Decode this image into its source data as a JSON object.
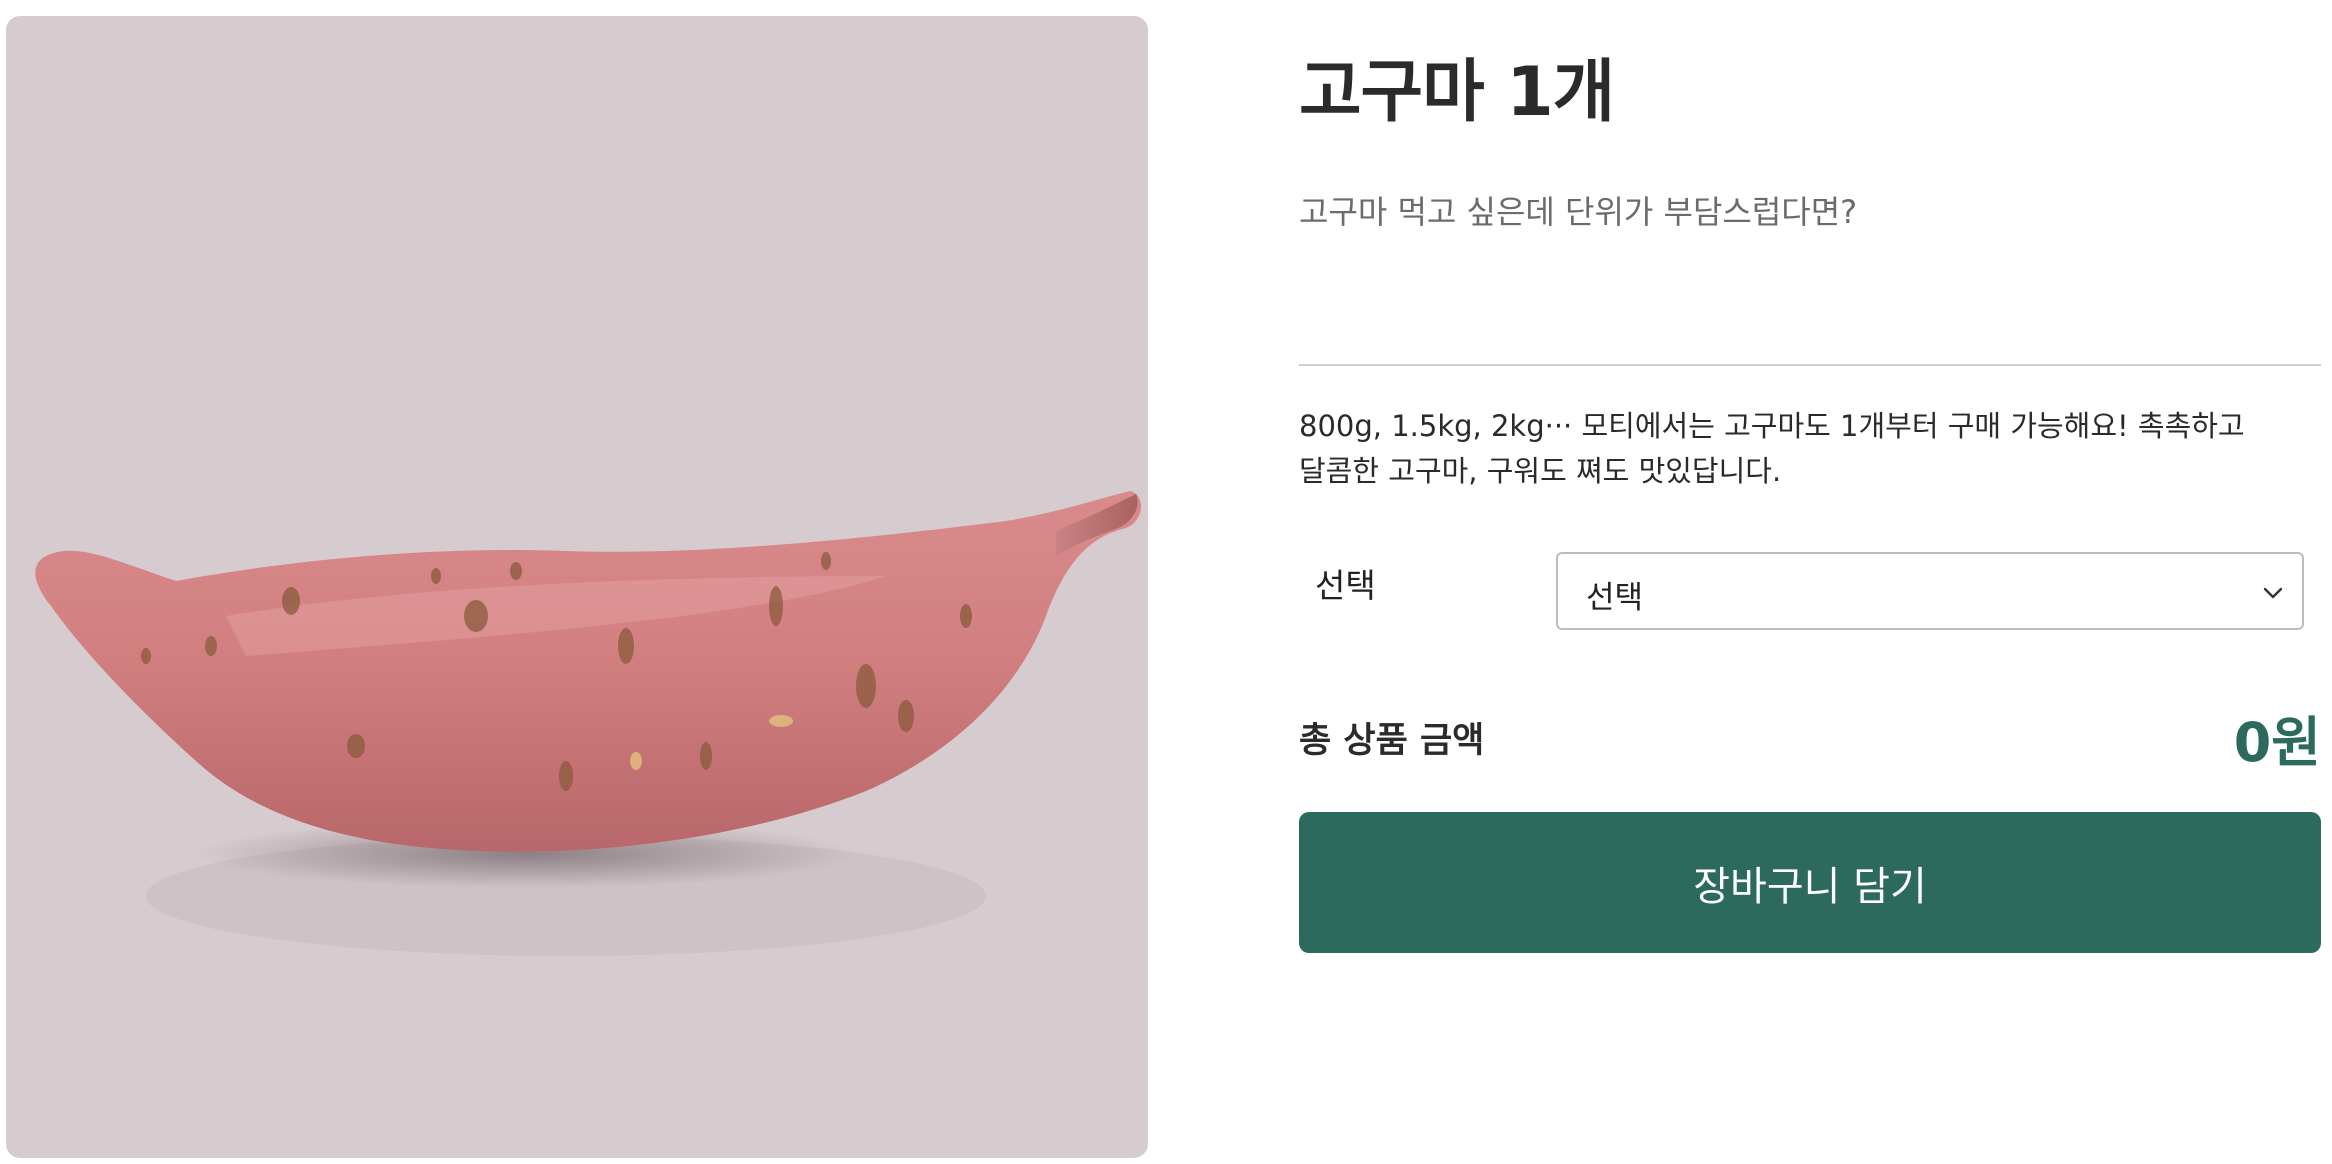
{
  "product": {
    "image_alt": "sweet-potato",
    "title": "고구마 1개",
    "subtitle": "고구마 먹고 싶은데 단위가 부담스럽다면?",
    "description": "800g, 1.5kg, 2kg··· 모티에서는 고구마도 1개부터 구매 가능해요! 촉촉하고 달콤한 고구마, 구워도 쪄도 맛있답니다."
  },
  "option": {
    "label": "선택",
    "selected": "선택",
    "icon": "chevron-down-icon"
  },
  "total": {
    "label": "총 상품 금액",
    "value": "0원"
  },
  "actions": {
    "add_to_cart": "장바구니 담기"
  },
  "colors": {
    "accent": "#2d6a5e",
    "image_background": "#d6cbcf",
    "divider": "#cfcfcf",
    "subtitle_text": "#6b6b6b"
  }
}
